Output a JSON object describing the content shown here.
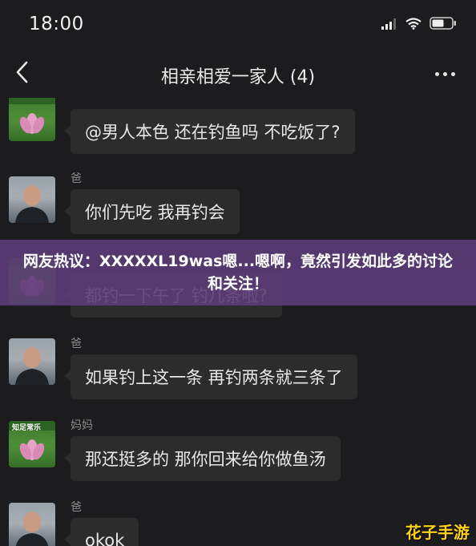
{
  "status_bar": {
    "time": "18:00"
  },
  "header": {
    "title": "相亲相爱一家人 (4)"
  },
  "messages": [
    {
      "sender": "",
      "text": "@男人本色 还在钓鱼吗 不吃饭了?",
      "avatar": "lotus-avatar"
    },
    {
      "sender": "爸",
      "text": "你们先吃 我再钓会",
      "avatar": "man-avatar"
    },
    {
      "sender": "",
      "text": "都钓一下午了 钓几条啦?",
      "avatar": "lotus-avatar"
    },
    {
      "sender": "爸",
      "text": "如果钓上这一条 再钓两条就三条了",
      "avatar": "man-avatar"
    },
    {
      "sender": "妈妈",
      "text": "那还挺多的 那你回来给你做鱼汤",
      "avatar": "lotus-avatar"
    },
    {
      "sender": "爸",
      "text": "okok",
      "avatar": "man-avatar"
    }
  ],
  "avatar_text": {
    "lotus": "知足常乐"
  },
  "overlay": {
    "caption": "网友热议：XXXXXL19was嗯...嗯啊，竟然引发如此多的讨论和关注！"
  },
  "watermark": {
    "text": "花子手游"
  },
  "colors": {
    "background": "#1c1c1e",
    "bubble": "#2c2c2c",
    "banner": "#5c3c76",
    "watermark": "#ffd21a"
  }
}
